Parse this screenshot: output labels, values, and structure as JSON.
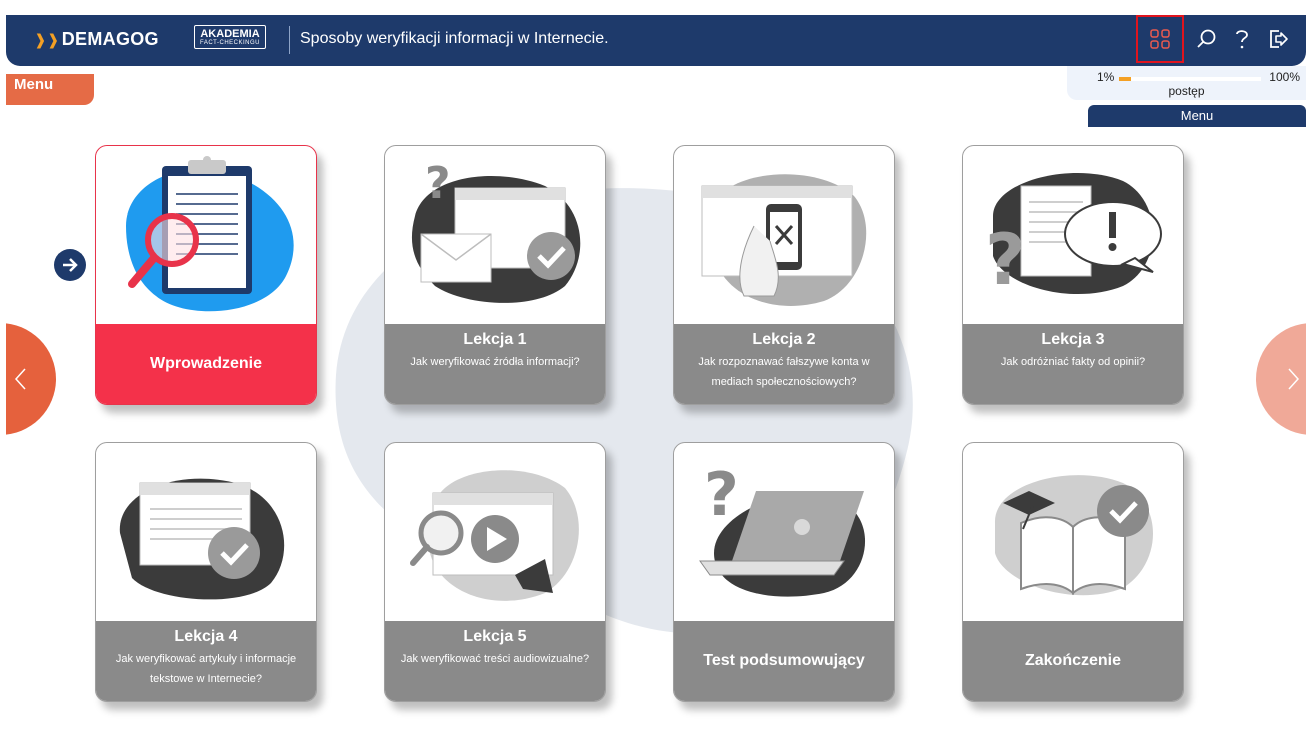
{
  "header": {
    "logo_demagog": "DEMAGOG",
    "logo_akademia": "AKADEMIA",
    "logo_akademia_sub": "FACT-CHECKINGU",
    "title": "Sposoby weryfikacji informacji w Internecie.",
    "icons": [
      "grid-icon",
      "search-icon",
      "help-icon",
      "exit-icon"
    ]
  },
  "menu_tab": "Menu",
  "progress": {
    "start_label": "1%",
    "end_label": "100%",
    "label": "postęp",
    "value": 0.01
  },
  "menu_button": "Menu",
  "cards": [
    {
      "title": "Wprowadzenie",
      "subtitle": "",
      "state": "active"
    },
    {
      "title": "Lekcja 1",
      "subtitle": "Jak weryfikować źródła informacji?"
    },
    {
      "title": "Lekcja 2",
      "subtitle": "Jak rozpoznawać fałszywe konta w mediach społecznościowych?"
    },
    {
      "title": "Lekcja 3",
      "subtitle": "Jak odróżniać fakty od opinii?"
    },
    {
      "title": "Lekcja 4",
      "subtitle": "Jak weryfikować artykuły i informacje tekstowe w Internecie?"
    },
    {
      "title": "Lekcja 5",
      "subtitle": "Jak weryfikować treści audiowizualne?"
    },
    {
      "title": "Test podsumowujący",
      "subtitle": ""
    },
    {
      "title": "Zakończenie",
      "subtitle": ""
    }
  ],
  "colors": {
    "navy": "#1e3a6b",
    "accent_red": "#f4314a",
    "card_grey": "#8a8a8a",
    "orange": "#e56b46"
  }
}
